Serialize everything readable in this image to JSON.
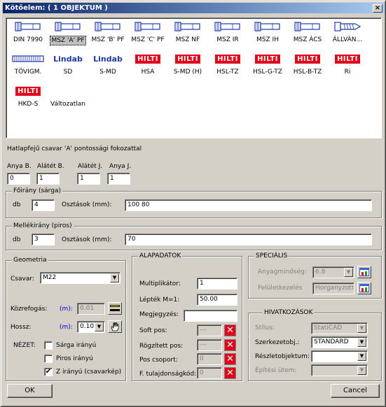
{
  "window": {
    "title": "Kötőelem: ( 1 OBJEKTUM )",
    "close_glyph": "×"
  },
  "catalog": {
    "items": [
      {
        "label": "DIN 7990",
        "kind": "bolt"
      },
      {
        "label": "MSZ 'A' PF",
        "kind": "bolt",
        "selected": true
      },
      {
        "label": "MSZ 'B' PF",
        "kind": "bolt"
      },
      {
        "label": "MSZ 'C' PF",
        "kind": "bolt"
      },
      {
        "label": "MSZ NF",
        "kind": "bolt"
      },
      {
        "label": "MSZ IR",
        "kind": "bolt"
      },
      {
        "label": "MSZ IH",
        "kind": "bolt"
      },
      {
        "label": "MSZ ÁCS",
        "kind": "bolt"
      },
      {
        "label": "ÁLLVÁN...",
        "kind": "screw"
      },
      {
        "label": "TÖVIGM.",
        "kind": "threaded"
      },
      {
        "label": "SD",
        "kind": "lindab",
        "brand": "Lindab"
      },
      {
        "label": "S-MD",
        "kind": "lindab",
        "brand": "Lindab"
      },
      {
        "label": "HSA",
        "kind": "hilti",
        "brand": "HILTI"
      },
      {
        "label": "S-MD (H)",
        "kind": "hilti",
        "brand": "HILTI"
      },
      {
        "label": "HSL-TZ",
        "kind": "hilti",
        "brand": "HILTI"
      },
      {
        "label": "HSL-G-TZ",
        "kind": "hilti",
        "brand": "HILTI"
      },
      {
        "label": "HSL-B-TZ",
        "kind": "hilti",
        "brand": "HILTI"
      },
      {
        "label": "Ri",
        "kind": "hilti",
        "brand": "HILTI"
      },
      {
        "label": "HKD-S",
        "kind": "hilti",
        "brand": "HILTI"
      },
      {
        "label": "Változatlan",
        "kind": "none"
      }
    ],
    "description": "Hatlapfejű csavar 'A' pontossági fokozattal"
  },
  "counts": {
    "anya_b": {
      "label": "Anya B.",
      "value": "0"
    },
    "alatet_b": {
      "label": "Alátét B.",
      "value": "1"
    },
    "alatet_j": {
      "label": "Alátét J.",
      "value": "1"
    },
    "anya_j": {
      "label": "Anya J.",
      "value": "1"
    }
  },
  "foirany": {
    "legend": "Főirány (sárga)",
    "db_label": "db",
    "db_value": "4",
    "osztasok_label": "Osztások (mm):",
    "osztasok_value": "100 80"
  },
  "mellekirany": {
    "legend": "Mellékirány (piros)",
    "db_label": "db",
    "db_value": "3",
    "osztasok_label": "Osztások (mm):",
    "osztasok_value": "70"
  },
  "geometria": {
    "legend": "Geometria",
    "csavar_label": "Csavar:",
    "csavar_value": "M22",
    "kozrefogas_label": "Közrefogás:",
    "kozrefogas_unit": "(m):",
    "kozrefogas_value": "0.01",
    "hossz_label": "Hossz:",
    "hossz_unit": "(m):",
    "hossz_value": "0.10",
    "nezet_label": "NÉZET:",
    "nezet_options": [
      {
        "label": "Sárga irányú",
        "checked": false
      },
      {
        "label": "Piros irányú",
        "checked": false
      },
      {
        "label": "Z irányú (csavarkép)",
        "checked": true
      }
    ],
    "check_glyph": "✔"
  },
  "alapadatok": {
    "legend": "ALAPADATOK",
    "multiplikator_label": "Multiplikátor:",
    "multiplikator_value": "1",
    "leptek_label": "Lépték M=1:",
    "leptek_value": "50.00",
    "megjegyzes_label": "Megjegyzés:",
    "megjegyzes_value": "",
    "soft_pos_label": "Soft pos:",
    "soft_pos_value": "---",
    "rogzitett_pos_label": "Rögzített pos:",
    "rogzitett_pos_value": "---",
    "pos_csoport_label": "Pos csoport:",
    "pos_csoport_value": "0",
    "f_tulajdonsagkod_label": "F. tulajdonságkód:",
    "f_tulajdonsagkod_value": "0",
    "x_glyph": "✕"
  },
  "specialis": {
    "legend": "SPECIÁLIS",
    "anyagminoseg_label": "Anyagminőség:",
    "anyagminoseg_value": "6.8",
    "feluletkezeles_label": "Felületkezelés",
    "feluletkezeles_value": "Horganyzott"
  },
  "hivatkozasok": {
    "legend": "HIVATKOZÁSOK",
    "stilus_label": "Stílus:",
    "stilus_value": "StatiCAD",
    "szerkezetobj_label": "Szerkezetobj.:",
    "szerkezetobj_value": "STANDARD",
    "reszletobjektum_label": "Részletobjektum:",
    "reszletobjektum_value": "",
    "epitesi_utem_label": "Építési ütem:",
    "epitesi_utem_value": ""
  },
  "buttons": {
    "ok": "OK",
    "cancel": "Cancel"
  },
  "arrow_glyph": "▼"
}
